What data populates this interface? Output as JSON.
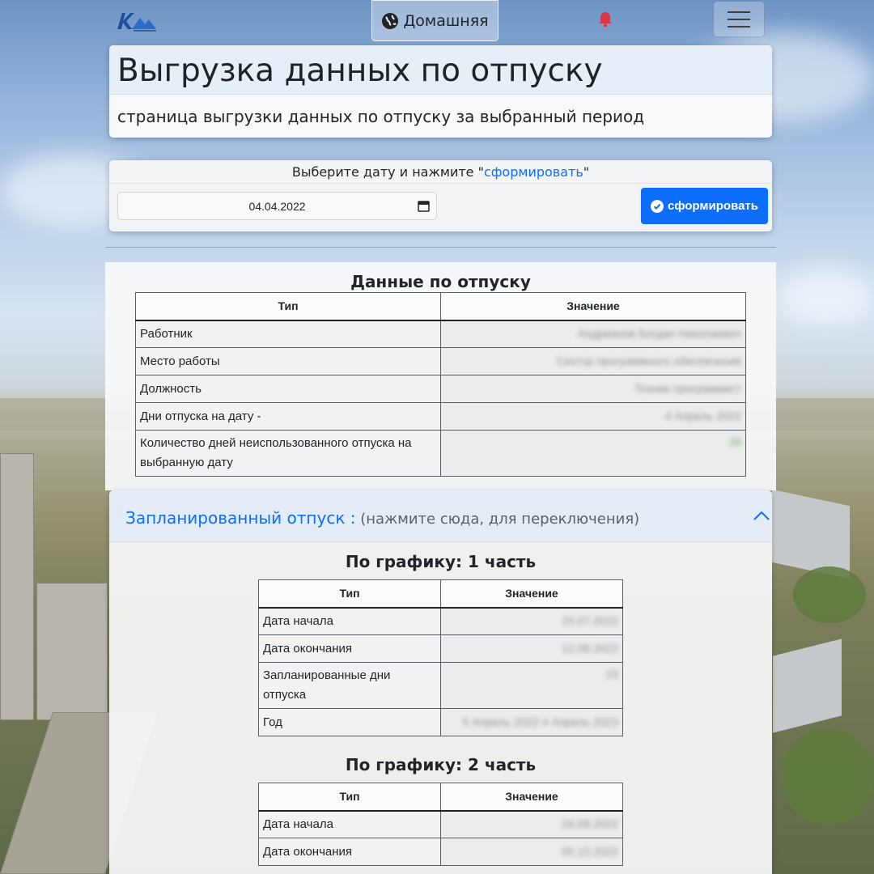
{
  "nav": {
    "home_label": "Домашняя"
  },
  "header": {
    "title": "Выгрузка данных по отпуску",
    "subtitle": "страница выгрузки данных по отпуску за выбранный период"
  },
  "form": {
    "hint_prefix": "Выберите дату и нажмите \"",
    "hint_link": "сформировать",
    "hint_suffix": "\"",
    "date_value": "04.04.2022",
    "submit_label": "сформировать"
  },
  "vacation_data": {
    "title": "Данные по отпуску",
    "columns": [
      "Тип",
      "Значение"
    ],
    "rows": [
      {
        "type": "Работник",
        "value": "Андрианов Богдан Николаевич"
      },
      {
        "type": "Место работы",
        "value": "Сектор программного обеспечения"
      },
      {
        "type": "Должность",
        "value": "Техник программист"
      },
      {
        "type": "Дни отпуска на дату -",
        "value": "4 Апрель 2022"
      },
      {
        "type": "Количество дней неиспользованного отпуска на выбранную дату",
        "value": "28"
      }
    ]
  },
  "planned": {
    "title": "Запланированный отпуск :",
    "hint": " (нажмите сюда, для переключения)",
    "parts": [
      {
        "title": "По графику: 1 часть",
        "columns": [
          "Тип",
          "Значение"
        ],
        "rows": [
          {
            "type": "Дата начала",
            "value": "25.07.2022"
          },
          {
            "type": "Дата окончания",
            "value": "12.08.2022"
          },
          {
            "type": "Запланированные дни отпуска",
            "value": "15"
          },
          {
            "type": "Год",
            "value": "5 Апрель 2022 4 Апрель 2023"
          }
        ]
      },
      {
        "title": "По графику: 2 часть",
        "columns": [
          "Тип",
          "Значение"
        ],
        "rows": [
          {
            "type": "Дата начала",
            "value": "24.09.2022"
          },
          {
            "type": "Дата окончания",
            "value": "05.10.2022"
          }
        ]
      }
    ]
  }
}
